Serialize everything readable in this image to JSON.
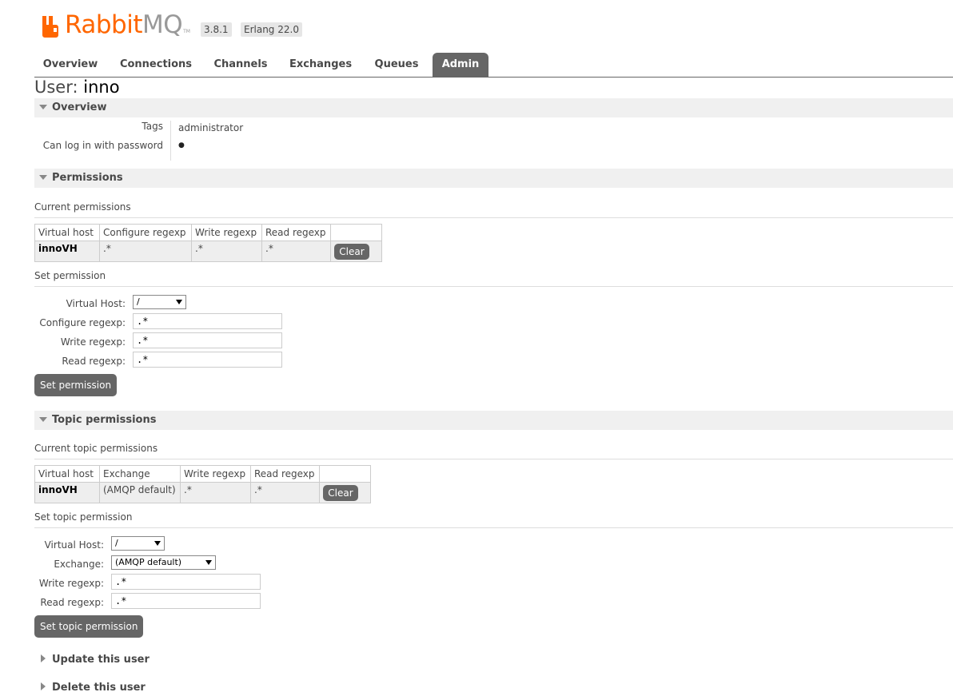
{
  "header": {
    "brand_rabbit": "Rabbit",
    "brand_mq": "MQ",
    "trademark": "TM",
    "version": "3.8.1",
    "erlang": "Erlang 22.0"
  },
  "tabs": [
    "Overview",
    "Connections",
    "Channels",
    "Exchanges",
    "Queues",
    "Admin"
  ],
  "page": {
    "title_prefix": "User: ",
    "username": "inno"
  },
  "overview": {
    "heading": "Overview",
    "tags_label": "Tags",
    "tags_value": "administrator",
    "login_label": "Can log in with password",
    "login_value": "●"
  },
  "permissions": {
    "heading": "Permissions",
    "current_heading": "Current permissions",
    "columns": [
      "Virtual host",
      "Configure regexp",
      "Write regexp",
      "Read regexp"
    ],
    "rows": [
      {
        "vhost": "innoVH",
        "configure": ".*",
        "write": ".*",
        "read": ".*",
        "action": "Clear"
      }
    ],
    "set_heading": "Set permission",
    "form": {
      "vhost_label": "Virtual Host:",
      "vhost_value": "/",
      "configure_label": "Configure regexp:",
      "configure_value": ".*",
      "write_label": "Write regexp:",
      "write_value": ".*",
      "read_label": "Read regexp:",
      "read_value": ".*",
      "submit": "Set permission"
    }
  },
  "topic_permissions": {
    "heading": "Topic permissions",
    "current_heading": "Current topic permissions",
    "columns": [
      "Virtual host",
      "Exchange",
      "Write regexp",
      "Read regexp"
    ],
    "rows": [
      {
        "vhost": "innoVH",
        "exchange": "(AMQP default)",
        "write": ".*",
        "read": ".*",
        "action": "Clear"
      }
    ],
    "set_heading": "Set topic permission",
    "form": {
      "vhost_label": "Virtual Host:",
      "vhost_value": "/",
      "exchange_label": "Exchange:",
      "exchange_value": "(AMQP default)",
      "write_label": "Write regexp:",
      "write_value": ".*",
      "read_label": "Read regexp:",
      "read_value": ".*",
      "submit": "Set topic permission"
    }
  },
  "update_user": {
    "heading": "Update this user"
  },
  "delete_user": {
    "heading": "Delete this user"
  },
  "colors": {
    "brand_orange": "#ff6600",
    "tab_active": "#666666",
    "section_bg": "#f0f0f0"
  }
}
